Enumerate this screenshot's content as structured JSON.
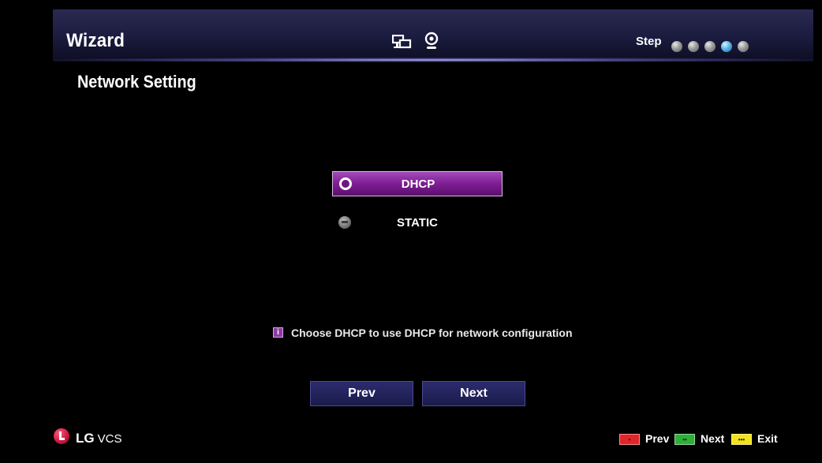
{
  "header": {
    "title": "Wizard",
    "step_label": "Step",
    "steps_total": 5,
    "current_step": 4
  },
  "section": {
    "title": "Network Setting"
  },
  "options": [
    {
      "label": "DHCP",
      "selected": true
    },
    {
      "label": "STATIC",
      "selected": false
    }
  ],
  "hint": {
    "icon": "info-icon",
    "text": "Choose DHCP to use DHCP for network configuration"
  },
  "buttons": {
    "prev": "Prev",
    "next": "Next"
  },
  "footer": {
    "brand": "LG",
    "product": "VCS",
    "keys": [
      {
        "color": "#e0262a",
        "label": "Prev",
        "icon": "red-key-icon"
      },
      {
        "color": "#2faf3a",
        "label": "Next",
        "icon": "green-key-icon"
      },
      {
        "color": "#f2e21b",
        "label": "Exit",
        "icon": "yellow-key-icon"
      }
    ]
  },
  "colors": {
    "accent_purple": "#7d1e92",
    "header_blue": "#1a1b3e",
    "button_blue": "#1b1b4c",
    "active_step": "#5ab6e6"
  }
}
